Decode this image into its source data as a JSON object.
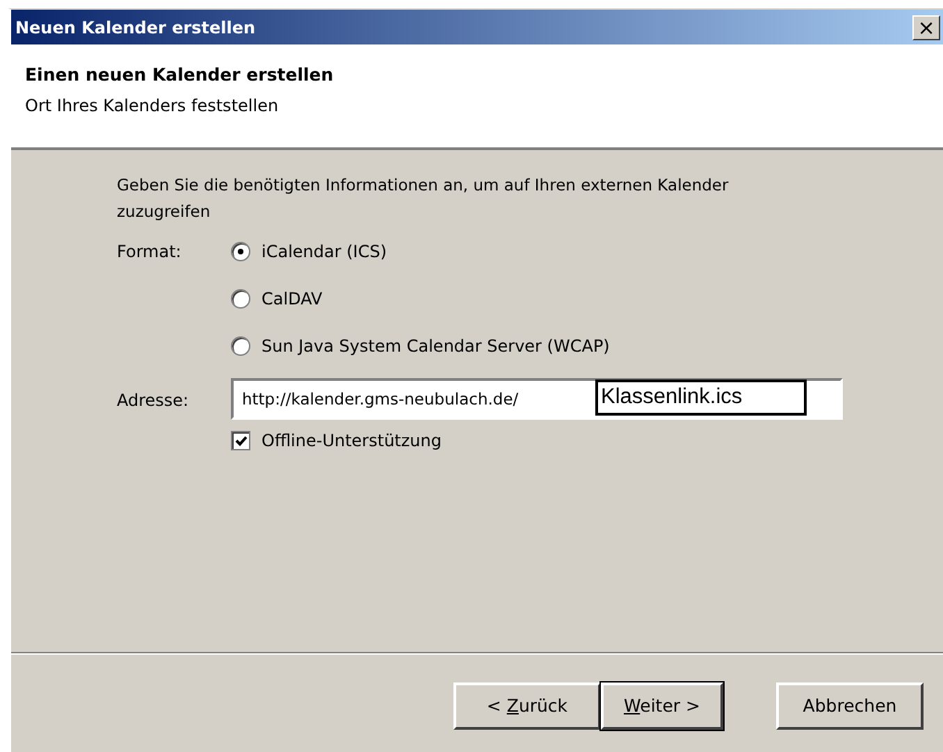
{
  "window": {
    "title": "Neuen Kalender erstellen",
    "close": "×"
  },
  "header": {
    "title": "Einen neuen Kalender erstellen",
    "subtitle": "Ort Ihres Kalenders feststellen"
  },
  "intro": "Geben Sie die benötigten Informationen an, um auf Ihren externen Kalender zuzugreifen",
  "format": {
    "label": "Format:",
    "options": [
      {
        "label": "iCalendar (ICS)",
        "selected": true
      },
      {
        "label": "CalDAV",
        "selected": false
      },
      {
        "label": "Sun Java System Calendar Server (WCAP)",
        "selected": false
      }
    ]
  },
  "address": {
    "label": "Adresse:",
    "value": "http://kalender.gms-neubulach.de/",
    "overlay": "Klassenlink.ics"
  },
  "offline": {
    "label": "Offline-Unterstützung",
    "checked": true
  },
  "buttons": [
    {
      "before": "< ",
      "accel": "Z",
      "after": "urück",
      "default": false
    },
    {
      "accel": "W",
      "after": "eiter >",
      "default": true
    },
    {
      "after": "Abbrechen",
      "default": false
    }
  ]
}
